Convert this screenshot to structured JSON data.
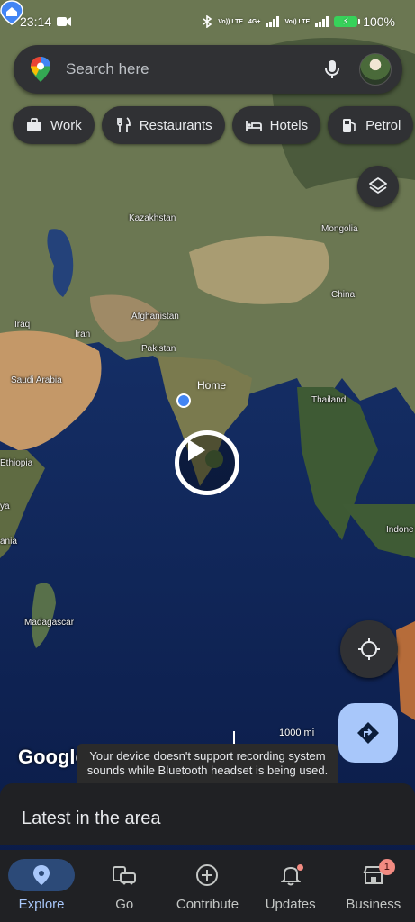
{
  "status_bar": {
    "time": "23:14",
    "net1": "Vo)) LTE",
    "net2": "4G+",
    "net3": "Vo)) LTE",
    "battery": "100%"
  },
  "search": {
    "placeholder": "Search here"
  },
  "chips": [
    {
      "label": "Work",
      "icon": "briefcase-icon"
    },
    {
      "label": "Restaurants",
      "icon": "fork-knife-icon"
    },
    {
      "label": "Hotels",
      "icon": "bed-icon"
    },
    {
      "label": "Petrol",
      "icon": "fuel-icon"
    }
  ],
  "map": {
    "labels": {
      "kazakhstan": "Kazakhstan",
      "mongolia": "Mongolia",
      "china": "China",
      "iraq": "Iraq",
      "iran": "Iran",
      "afghanistan": "Afghanistan",
      "pakistan": "Pakistan",
      "saudi_arabia": "Saudi Arabia",
      "thailand": "Thailand",
      "ethiopia": "Ethiopia",
      "kenya": "ya",
      "tanzania": "ania",
      "indonesia": "Indone",
      "madagascar": "Madagascar"
    },
    "home_label": "Home",
    "scale": "1000 mi",
    "logo": "Google"
  },
  "toast": "Your device doesn't support recording system sounds while Bluetooth headset is being used.",
  "sheet": {
    "title": "Latest in the area"
  },
  "nav": [
    {
      "label": "Explore",
      "active": true
    },
    {
      "label": "Go"
    },
    {
      "label": "Contribute"
    },
    {
      "label": "Updates"
    },
    {
      "label": "Business",
      "badge": "1"
    }
  ]
}
